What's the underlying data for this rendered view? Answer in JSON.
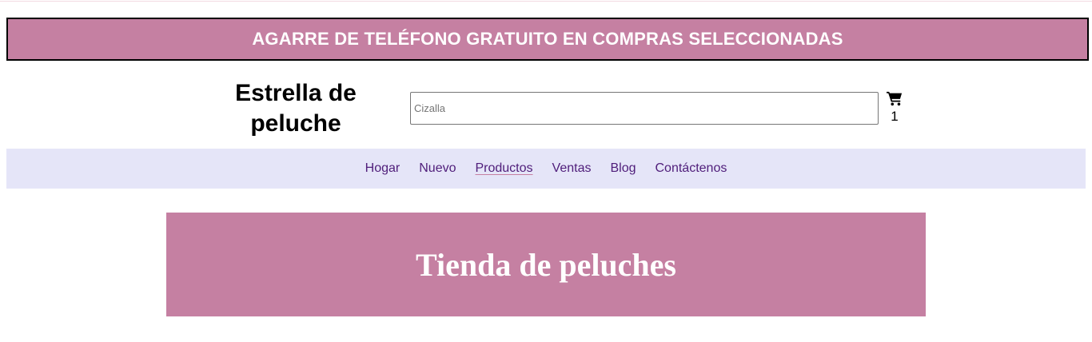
{
  "promo": {
    "text": "AGARRE DE TELÉFONO GRATUITO EN COMPRAS SELECCIONADAS"
  },
  "header": {
    "brand_line1": "Estrella de",
    "brand_line2": "peluche",
    "search_placeholder": "Cizalla",
    "cart_icon": "shopping-cart-icon",
    "cart_count": "1"
  },
  "nav": {
    "items": [
      {
        "label": "Hogar",
        "active": false
      },
      {
        "label": "Nuevo",
        "active": false
      },
      {
        "label": "Productos",
        "active": true
      },
      {
        "label": "Ventas",
        "active": false
      },
      {
        "label": "Blog",
        "active": false
      },
      {
        "label": "Contáctenos",
        "active": false
      }
    ]
  },
  "hero": {
    "title": "Tienda de peluches"
  },
  "colors": {
    "accent_pink": "#c580a2",
    "nav_background": "#e5e5f8",
    "nav_link": "#4f1d7a"
  }
}
